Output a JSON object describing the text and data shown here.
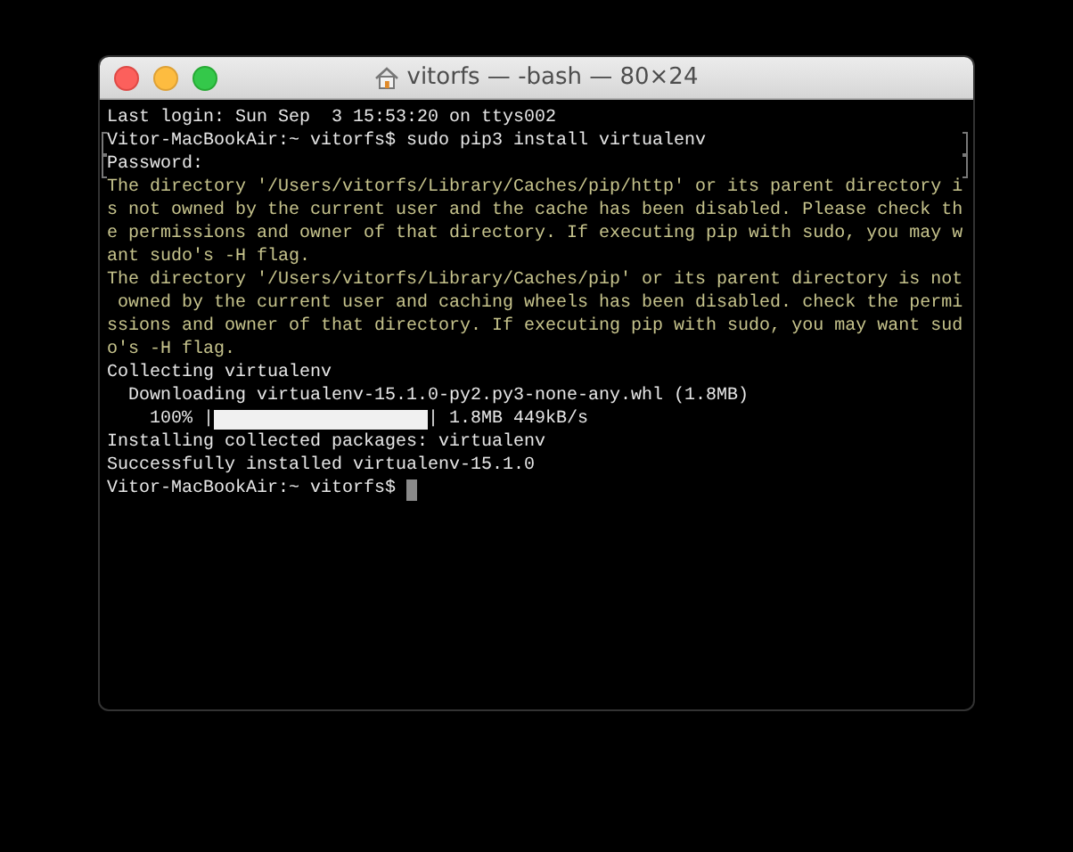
{
  "window": {
    "title": "vitorfs — -bash — 80×24"
  },
  "lines": [
    {
      "kind": "plain",
      "text": "Last login: Sun Sep  3 15:53:20 on ttys002",
      "marked": false
    },
    {
      "kind": "plain",
      "text": "Vitor-MacBookAir:~ vitorfs$ sudo pip3 install virtualenv",
      "marked": true
    },
    {
      "kind": "plain",
      "text": "Password:",
      "marked": true
    },
    {
      "kind": "warning",
      "text": "The directory '/Users/vitorfs/Library/Caches/pip/http' or its parent directory i",
      "marked": false
    },
    {
      "kind": "warning",
      "text": "s not owned by the current user and the cache has been disabled. Please check th",
      "marked": false
    },
    {
      "kind": "warning",
      "text": "e permissions and owner of that directory. If executing pip with sudo, you may w",
      "marked": false
    },
    {
      "kind": "warning",
      "text": "ant sudo's -H flag.",
      "marked": false
    },
    {
      "kind": "warning",
      "text": "The directory '/Users/vitorfs/Library/Caches/pip' or its parent directory is not",
      "marked": false
    },
    {
      "kind": "warning",
      "text": " owned by the current user and caching wheels has been disabled. check the permi",
      "marked": false
    },
    {
      "kind": "warning",
      "text": "ssions and owner of that directory. If executing pip with sudo, you may want sud",
      "marked": false
    },
    {
      "kind": "warning",
      "text": "o's -H flag.",
      "marked": false
    },
    {
      "kind": "plain",
      "text": "Collecting virtualenv",
      "marked": false
    },
    {
      "kind": "plain",
      "text": "  Downloading virtualenv-15.1.0-py2.py3-none-any.whl (1.8MB)",
      "marked": false
    },
    {
      "kind": "progress",
      "before": "    100% |",
      "level": 1,
      "after": "| 1.8MB 449kB/s",
      "marked": false
    },
    {
      "kind": "plain",
      "text": "Installing collected packages: virtualenv",
      "marked": false
    },
    {
      "kind": "plain",
      "text": "Successfully installed virtualenv-15.1.0",
      "marked": false
    },
    {
      "kind": "prompt",
      "text": "Vitor-MacBookAir:~ vitorfs$ ",
      "marked": false
    }
  ]
}
